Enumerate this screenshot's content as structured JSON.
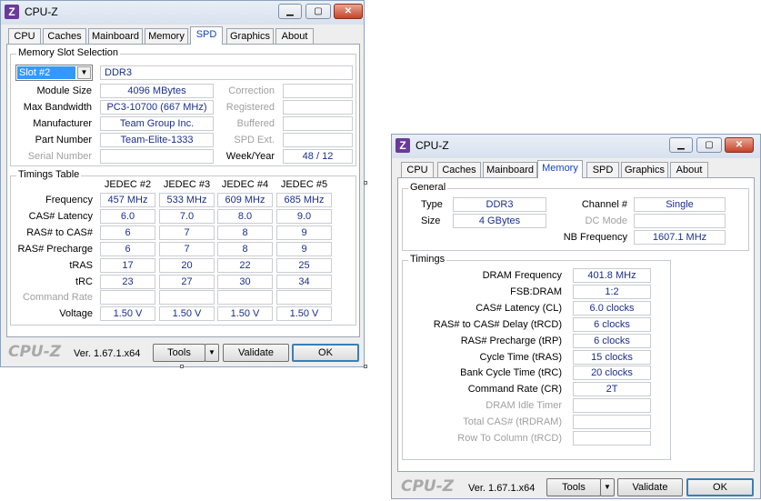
{
  "w1": {
    "title": "CPU-Z",
    "logo": "Z",
    "tabs": [
      "CPU",
      "Caches",
      "Mainboard",
      "Memory",
      "SPD",
      "Graphics",
      "About"
    ],
    "slot_group_label": "Memory Slot Selection",
    "slot_selected": "Slot #2",
    "mem_type": "DDR3",
    "rows": {
      "module_size": {
        "label": "Module Size",
        "value": "4096 MBytes"
      },
      "max_bandwidth": {
        "label": "Max Bandwidth",
        "value": "PC3-10700 (667 MHz)"
      },
      "manufacturer": {
        "label": "Manufacturer",
        "value": "Team Group Inc."
      },
      "part_number": {
        "label": "Part Number",
        "value": "Team-Elite-1333"
      },
      "serial_number": {
        "label": "Serial Number",
        "value": ""
      }
    },
    "right_labels": {
      "correction": "Correction",
      "registered": "Registered",
      "buffered": "Buffered",
      "spd_ext": "SPD Ext.",
      "week_year": "Week/Year"
    },
    "week_year_value": "48 / 12",
    "timings_label": "Timings Table",
    "jedec_headers": [
      "JEDEC #2",
      "JEDEC #3",
      "JEDEC #4",
      "JEDEC #5"
    ],
    "timing_rows": [
      {
        "label": "Frequency",
        "values": [
          "457 MHz",
          "533 MHz",
          "609 MHz",
          "685 MHz"
        ]
      },
      {
        "label": "CAS# Latency",
        "values": [
          "6.0",
          "7.0",
          "8.0",
          "9.0"
        ]
      },
      {
        "label": "RAS# to CAS#",
        "values": [
          "6",
          "7",
          "8",
          "9"
        ]
      },
      {
        "label": "RAS# Precharge",
        "values": [
          "6",
          "7",
          "8",
          "9"
        ]
      },
      {
        "label": "tRAS",
        "values": [
          "17",
          "20",
          "22",
          "25"
        ]
      },
      {
        "label": "tRC",
        "values": [
          "23",
          "27",
          "30",
          "34"
        ]
      },
      {
        "label": "Command Rate",
        "values": [
          "",
          "",
          "",
          ""
        ]
      },
      {
        "label": "Voltage",
        "values": [
          "1.50 V",
          "1.50 V",
          "1.50 V",
          "1.50 V"
        ]
      }
    ],
    "brand": "CPU-Z",
    "version": "Ver. 1.67.1.x64",
    "tools": "Tools",
    "validate": "Validate",
    "ok": "OK"
  },
  "w2": {
    "title": "CPU-Z",
    "logo": "Z",
    "tabs": [
      "CPU",
      "Caches",
      "Mainboard",
      "Memory",
      "SPD",
      "Graphics",
      "About"
    ],
    "general_label": "General",
    "type_label": "Type",
    "type_value": "DDR3",
    "size_label": "Size",
    "size_value": "4 GBytes",
    "channel_label": "Channel #",
    "channel_value": "Single",
    "dc_mode_label": "DC Mode",
    "nb_freq_label": "NB Frequency",
    "nb_freq_value": "1607.1 MHz",
    "timings_label": "Timings",
    "timings": [
      {
        "label": "DRAM Frequency",
        "value": "401.8 MHz"
      },
      {
        "label": "FSB:DRAM",
        "value": "1:2"
      },
      {
        "label": "CAS# Latency (CL)",
        "value": "6.0 clocks"
      },
      {
        "label": "RAS# to CAS# Delay (tRCD)",
        "value": "6 clocks"
      },
      {
        "label": "RAS# Precharge (tRP)",
        "value": "6 clocks"
      },
      {
        "label": "Cycle Time (tRAS)",
        "value": "15 clocks"
      },
      {
        "label": "Bank Cycle Time (tRC)",
        "value": "20 clocks"
      },
      {
        "label": "Command Rate (CR)",
        "value": "2T"
      },
      {
        "label": "DRAM Idle Timer",
        "value": ""
      },
      {
        "label": "Total CAS# (tRDRAM)",
        "value": ""
      },
      {
        "label": "Row To Column (tRCD)",
        "value": ""
      }
    ],
    "brand": "CPU-Z",
    "version": "Ver. 1.67.1.x64",
    "tools": "Tools",
    "validate": "Validate",
    "ok": "OK"
  }
}
